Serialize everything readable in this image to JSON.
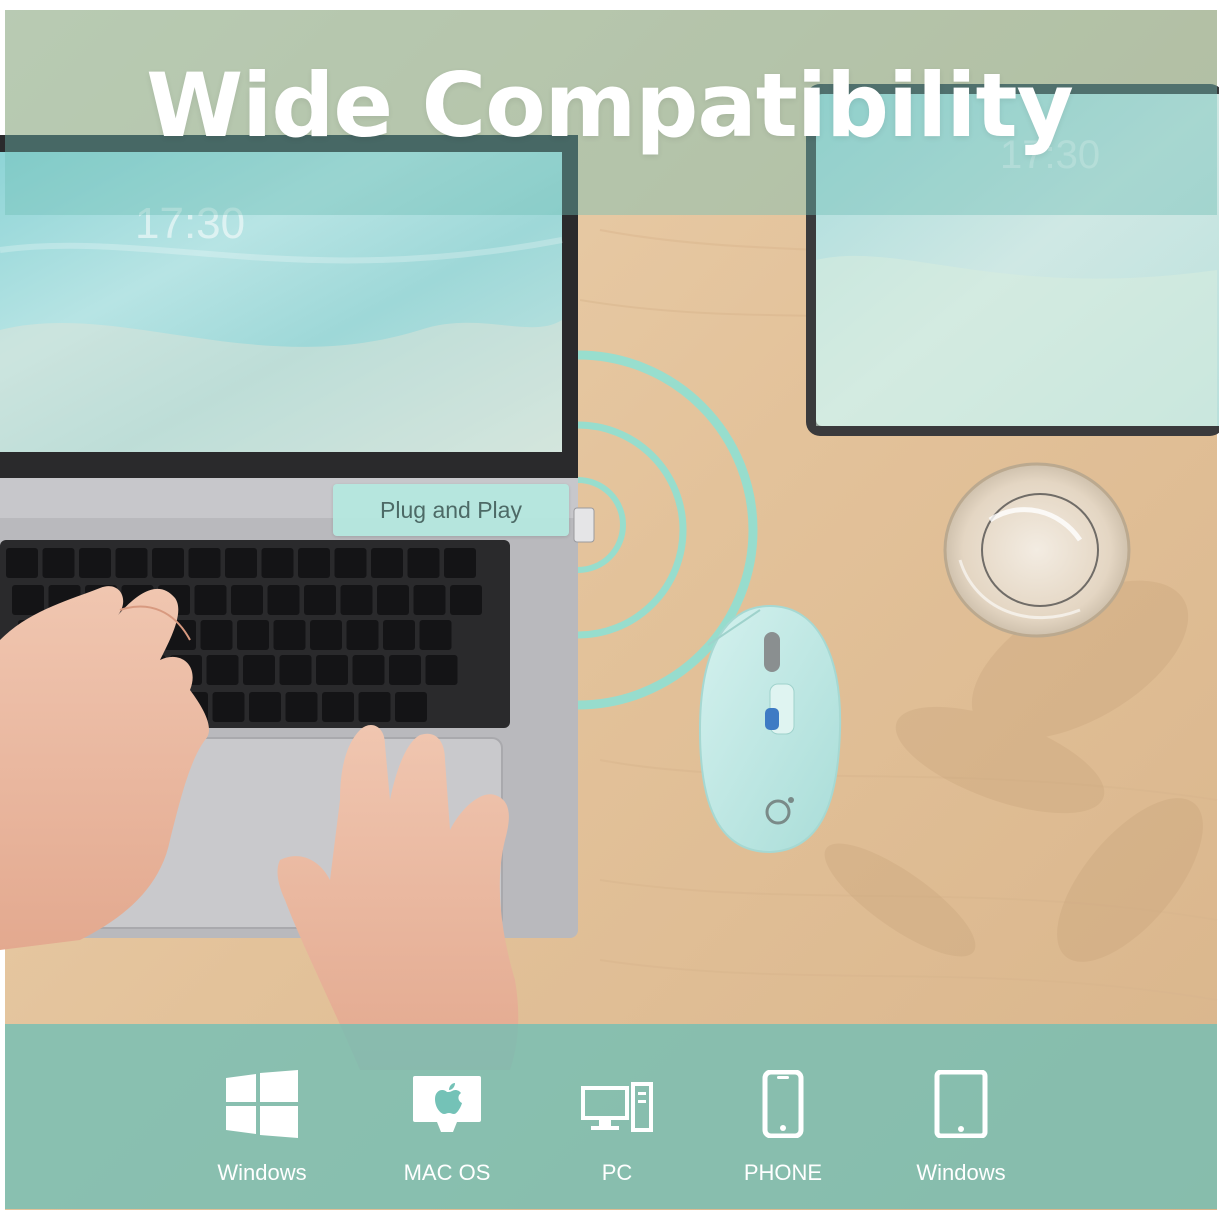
{
  "headline": "Wide Compatibility",
  "badge": "Plug and Play",
  "screen_clock": "17:30",
  "colors": {
    "accent_teal": "#74c2b7",
    "wood": "#e6c69e",
    "mouse": "#bfe9e6",
    "signal_ring": "#8fe0d3"
  },
  "platforms": [
    {
      "label": "Windows",
      "icon": "windows-logo-icon"
    },
    {
      "label": "MAC OS",
      "icon": "apple-monitor-icon"
    },
    {
      "label": "PC",
      "icon": "desktop-pc-icon"
    },
    {
      "label": "PHONE",
      "icon": "smartphone-icon"
    },
    {
      "label": "Windows",
      "icon": "tablet-icon"
    }
  ]
}
